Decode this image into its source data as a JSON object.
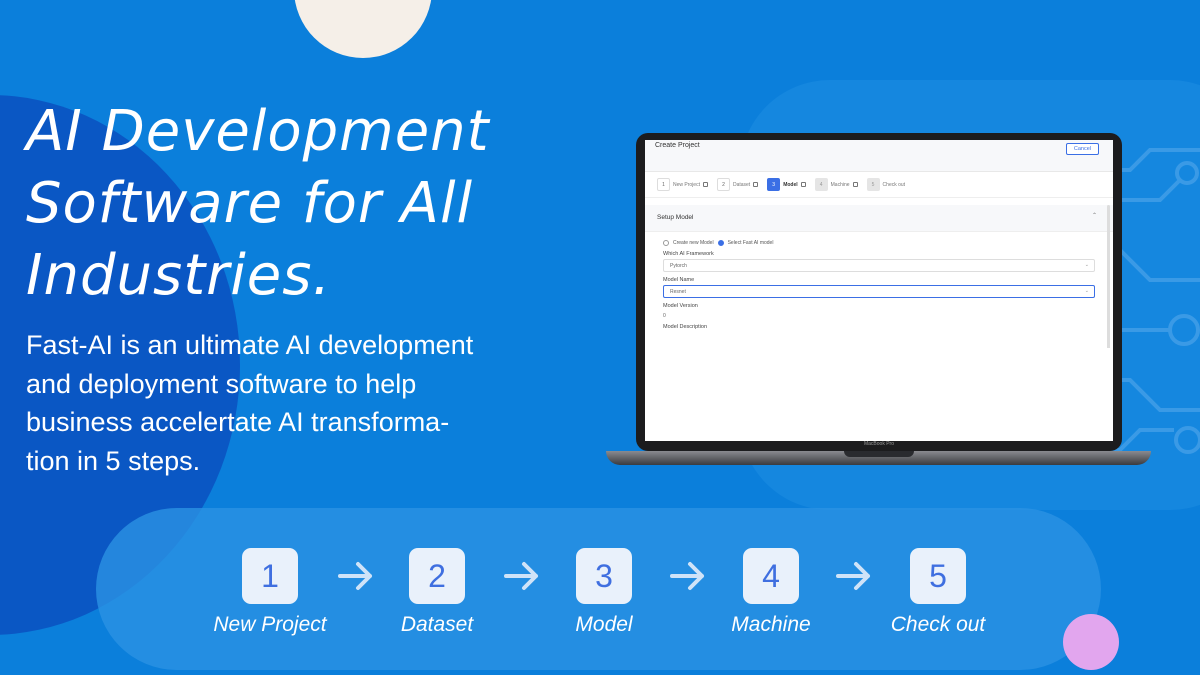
{
  "headline": {
    "lines": [
      "AI Development",
      "Software for All",
      "Industries."
    ]
  },
  "description": {
    "lines": [
      "Fast-AI is an ultimate AI development",
      "and deployment software to help",
      "business accelertate AI transforma-",
      "tion in 5 steps."
    ]
  },
  "colors": {
    "background": "#0b7fdb",
    "accent": "#3f6fe0",
    "step_tile": "#e9f1fb"
  },
  "app": {
    "title": "Create Project",
    "cancel_label": "Cancel",
    "steps": [
      {
        "num": "1",
        "label": "New Project"
      },
      {
        "num": "2",
        "label": "Dataset"
      },
      {
        "num": "3",
        "label": "Model"
      },
      {
        "num": "4",
        "label": "Machine"
      },
      {
        "num": "5",
        "label": "Check out"
      }
    ],
    "section_title": "Setup Model",
    "radio_create": "Create new Model",
    "radio_select": "Select Fast AI model",
    "framework_label": "Which AI Framework",
    "framework_value": "Pytorch",
    "model_name_label": "Model Name",
    "model_name_value": "Resnet",
    "model_version_label": "Model Version",
    "model_version_value": "0",
    "model_desc_label": "Model Description",
    "device_brand": "MacBook Pro"
  },
  "workflow": {
    "steps": [
      {
        "num": "1",
        "label": "New Project"
      },
      {
        "num": "2",
        "label": "Dataset"
      },
      {
        "num": "3",
        "label": "Model"
      },
      {
        "num": "4",
        "label": "Machine"
      },
      {
        "num": "5",
        "label": "Check out"
      }
    ],
    "arrow_icon": "arrow-right-icon"
  }
}
